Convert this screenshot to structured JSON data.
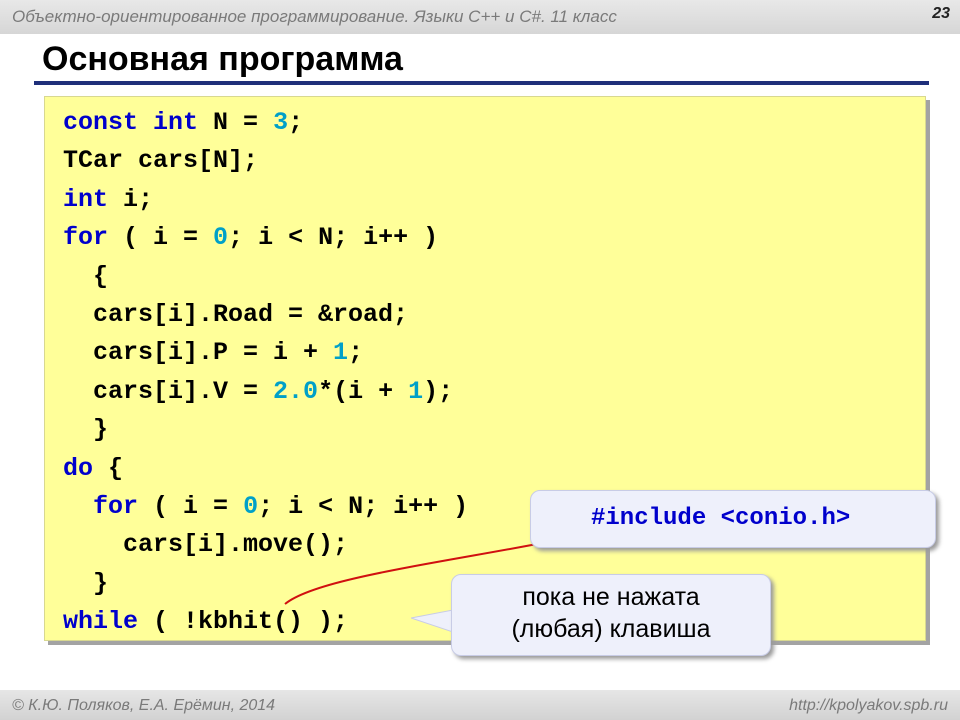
{
  "header": {
    "course_title": "Объектно-ориентированное программирование. Языки C++ и C#. 11 класс",
    "page_number": "23"
  },
  "slide": {
    "title": "Основная программа"
  },
  "code": {
    "lines": [
      [
        {
          "t": "const",
          "c": "kw"
        },
        {
          "t": " ",
          "c": ""
        },
        {
          "t": "int",
          "c": "kw"
        },
        {
          "t": " N = ",
          "c": ""
        },
        {
          "t": "3",
          "c": "num"
        },
        {
          "t": ";",
          "c": ""
        }
      ],
      [
        {
          "t": "TCar cars[N];",
          "c": ""
        }
      ],
      [
        {
          "t": "int",
          "c": "kw"
        },
        {
          "t": " i;",
          "c": ""
        }
      ],
      [
        {
          "t": "for",
          "c": "kw"
        },
        {
          "t": " ( i = ",
          "c": ""
        },
        {
          "t": "0",
          "c": "num"
        },
        {
          "t": "; i < N; i++ )",
          "c": ""
        }
      ],
      [
        {
          "t": "  {",
          "c": ""
        }
      ],
      [
        {
          "t": "  cars[i].Road = &road;",
          "c": ""
        }
      ],
      [
        {
          "t": "  cars[i].P = i + ",
          "c": ""
        },
        {
          "t": "1",
          "c": "num"
        },
        {
          "t": ";",
          "c": ""
        }
      ],
      [
        {
          "t": "  cars[i].V = ",
          "c": ""
        },
        {
          "t": "2.0",
          "c": "num"
        },
        {
          "t": "*(i + ",
          "c": ""
        },
        {
          "t": "1",
          "c": "num"
        },
        {
          "t": ");",
          "c": ""
        }
      ],
      [
        {
          "t": "  }",
          "c": ""
        }
      ],
      [
        {
          "t": "do",
          "c": "kw"
        },
        {
          "t": " {",
          "c": ""
        }
      ],
      [
        {
          "t": "  ",
          "c": ""
        },
        {
          "t": "for",
          "c": "kw"
        },
        {
          "t": " ( i = ",
          "c": ""
        },
        {
          "t": "0",
          "c": "num"
        },
        {
          "t": "; i < N; i++ )",
          "c": ""
        }
      ],
      [
        {
          "t": "    cars[i].move();",
          "c": ""
        }
      ],
      [
        {
          "t": "  }",
          "c": ""
        }
      ],
      [
        {
          "t": "while",
          "c": "kw"
        },
        {
          "t": " ( !kbhit() );",
          "c": ""
        }
      ]
    ]
  },
  "callouts": {
    "include_text": "#include <conio.h>",
    "hint_line1": "пока не нажата",
    "hint_line2": "(любая) клавиша"
  },
  "footer": {
    "authors": "© К.Ю. Поляков, Е.А. Ерёмин, 2014",
    "url": "http://kpolyakov.spb.ru"
  },
  "colors": {
    "keyword": "#0000cc",
    "number": "#00a0c8",
    "code_background": "#ffff99",
    "title_rule": "#1f2f7a",
    "arrow": "#d01010"
  }
}
